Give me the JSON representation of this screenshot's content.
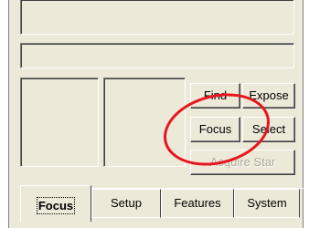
{
  "panel": {
    "buttons": {
      "find": "Find",
      "expose": "Expose",
      "focus": "Focus",
      "select": "Select",
      "acquire_star": "Acquire Star"
    }
  },
  "tabs": [
    {
      "label": "Focus",
      "active": true
    },
    {
      "label": "Setup",
      "active": false
    },
    {
      "label": "Features",
      "active": false
    },
    {
      "label": "System",
      "active": false
    }
  ],
  "annotation": {
    "color": "#e8141e"
  }
}
